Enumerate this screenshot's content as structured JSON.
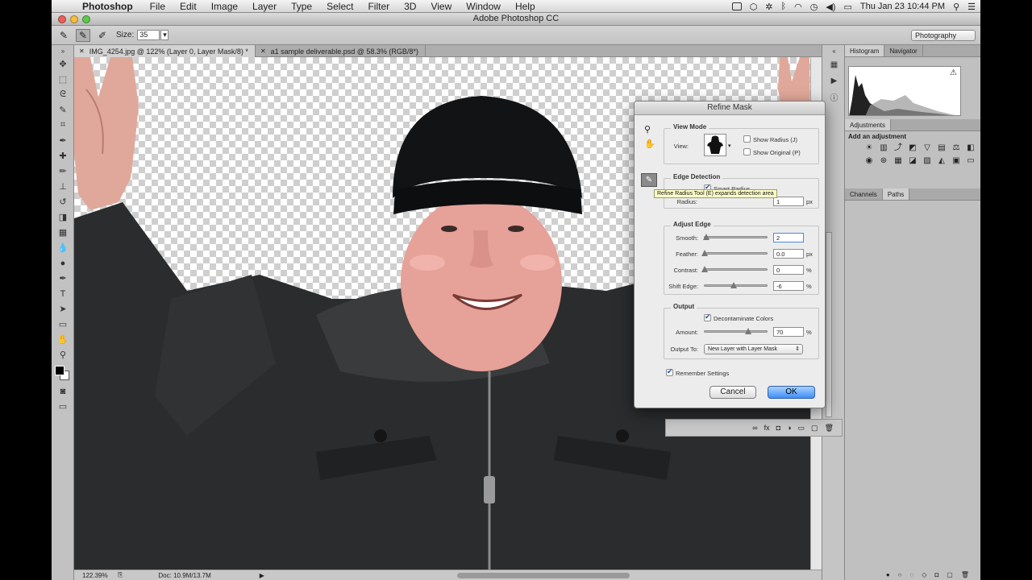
{
  "menubar": {
    "app_name": "Photoshop",
    "items": [
      "File",
      "Edit",
      "Image",
      "Layer",
      "Type",
      "Select",
      "Filter",
      "3D",
      "View",
      "Window",
      "Help"
    ],
    "clock": "Thu Jan 23  10:44 PM"
  },
  "window": {
    "title": "Adobe Photoshop CC"
  },
  "options": {
    "size_label": "Size:",
    "size_value": "35",
    "workspace": "Photography"
  },
  "doc_tabs": [
    {
      "label": "IMG_4254.jpg @ 122% (Layer 0, Layer Mask/8) *"
    },
    {
      "label": "a1 sample deliverable.psd @ 58.3% (RGB/8*)"
    }
  ],
  "status": {
    "zoom": "122.39%",
    "doc": "Doc: 10.9M/13.7M"
  },
  "panels": {
    "histogram_tab": "Histogram",
    "navigator_tab": "Navigator",
    "warning_glyph": "⚠",
    "adjustments_tab": "Adjustments",
    "add_adjustment": "Add an adjustment",
    "channels_tab": "Channels",
    "paths_tab": "Paths"
  },
  "dialog": {
    "title": "Refine Mask",
    "view_mode": {
      "group_title": "View Mode",
      "view_label": "View:",
      "show_radius": "Show Radius (J)",
      "show_radius_checked": false,
      "show_original": "Show Original (P)",
      "show_original_checked": false
    },
    "edge_detection": {
      "group_title": "Edge Detection",
      "smart_radius": "Smart Radius",
      "smart_radius_checked": true,
      "radius_label": "Radius:",
      "radius_value": "1",
      "radius_unit": "px",
      "tooltip": "Refine Radius Tool (E) expands detection area"
    },
    "adjust_edge": {
      "group_title": "Adjust Edge",
      "smooth_label": "Smooth:",
      "smooth_value": "2",
      "feather_label": "Feather:",
      "feather_value": "0.0",
      "feather_unit": "px",
      "contrast_label": "Contrast:",
      "contrast_value": "0",
      "contrast_unit": "%",
      "shift_label": "Shift Edge:",
      "shift_value": "-6",
      "shift_unit": "%"
    },
    "output": {
      "group_title": "Output",
      "decontaminate": "Decontaminate Colors",
      "decontaminate_checked": true,
      "amount_label": "Amount:",
      "amount_value": "70",
      "amount_unit": "%",
      "output_to_label": "Output To:",
      "output_to_value": "New Layer with Layer Mask"
    },
    "remember": "Remember Settings",
    "remember_checked": true,
    "cancel": "Cancel",
    "ok": "OK"
  }
}
